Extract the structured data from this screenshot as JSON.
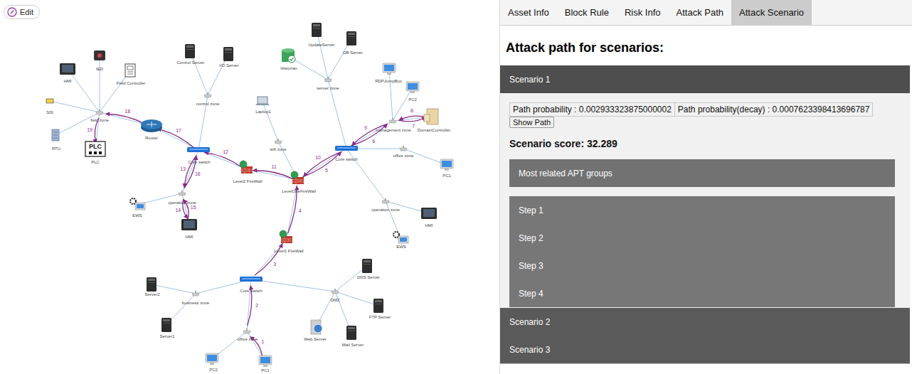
{
  "edit_button": {
    "label": "Edit"
  },
  "diagram": {
    "nodes": [
      {
        "label": "HMI",
        "kind": "hmi"
      },
      {
        "label": "IED",
        "kind": "ied"
      },
      {
        "label": "Field Controller",
        "kind": "controller"
      },
      {
        "label": "SIS",
        "kind": "sis"
      },
      {
        "label": "RTU",
        "kind": "rtu"
      },
      {
        "label": "PLC",
        "kind": "plc",
        "badge": "PLC"
      },
      {
        "label": "field zone",
        "kind": "hub"
      },
      {
        "label": "Router",
        "kind": "router"
      },
      {
        "label": "Control Server",
        "kind": "server"
      },
      {
        "label": "I/O Server",
        "kind": "server"
      },
      {
        "label": "control zone",
        "kind": "hub"
      },
      {
        "label": "Core switch",
        "kind": "switch"
      },
      {
        "label": "Level2 FireWall",
        "kind": "firewall"
      },
      {
        "label": "operation zone",
        "kind": "hub"
      },
      {
        "label": "EWS",
        "kind": "ews"
      },
      {
        "label": "HMI",
        "kind": "hmi"
      },
      {
        "label": "Laptop1",
        "kind": "laptop"
      },
      {
        "label": "wifi zone",
        "kind": "hub"
      },
      {
        "label": "LevelOneFireWall",
        "kind": "firewall"
      },
      {
        "label": "UpdateServer",
        "kind": "server"
      },
      {
        "label": "DB Server",
        "kind": "server"
      },
      {
        "label": "Historian",
        "kind": "db"
      },
      {
        "label": "server zone",
        "kind": "hub"
      },
      {
        "label": "RDPJumpBox",
        "kind": "pc"
      },
      {
        "label": "PC2",
        "kind": "pc"
      },
      {
        "label": "DomainController",
        "kind": "tower"
      },
      {
        "label": "management zone",
        "kind": "hub"
      },
      {
        "label": "Core switch",
        "kind": "switch"
      },
      {
        "label": "office zone",
        "kind": "hub"
      },
      {
        "label": "PC1",
        "kind": "pc"
      },
      {
        "label": "operation zone",
        "kind": "hub"
      },
      {
        "label": "HMI",
        "kind": "hmi"
      },
      {
        "label": "EWS",
        "kind": "ews"
      },
      {
        "label": "Level1 FireWall",
        "kind": "firewall"
      },
      {
        "label": "Core switch",
        "kind": "switch"
      },
      {
        "label": "business zone",
        "kind": "hub"
      },
      {
        "label": "Server2",
        "kind": "server"
      },
      {
        "label": "Server1",
        "kind": "server"
      },
      {
        "label": "office zone",
        "kind": "hub"
      },
      {
        "label": "PC2",
        "kind": "pc"
      },
      {
        "label": "PC1",
        "kind": "pc"
      },
      {
        "label": "DMZ",
        "kind": "hub"
      },
      {
        "label": "DNS Server",
        "kind": "server"
      },
      {
        "label": "FTP Server",
        "kind": "server"
      },
      {
        "label": "Web Server",
        "kind": "web"
      },
      {
        "label": "Mail Server",
        "kind": "server"
      }
    ],
    "attack_path": [
      {
        "step": "1"
      },
      {
        "step": "2"
      },
      {
        "step": "3"
      },
      {
        "step": "4"
      },
      {
        "step": "5"
      },
      {
        "step": "6"
      },
      {
        "step": "7"
      },
      {
        "step": "8"
      },
      {
        "step": "9"
      },
      {
        "step": "10"
      },
      {
        "step": "11"
      },
      {
        "step": "12"
      },
      {
        "step": "13"
      },
      {
        "step": "14"
      },
      {
        "step": "15"
      },
      {
        "step": "16"
      },
      {
        "step": "17"
      },
      {
        "step": "18"
      },
      {
        "step": "19"
      }
    ]
  },
  "tabs": [
    {
      "label": "Asset Info",
      "selected": false
    },
    {
      "label": "Block Rule",
      "selected": false
    },
    {
      "label": "Risk Info",
      "selected": false
    },
    {
      "label": "Attack Path",
      "selected": false
    },
    {
      "label": "Attack Scenario",
      "selected": true
    }
  ],
  "heading": "Attack path for scenarios:",
  "scenarios": [
    {
      "title": "Scenario 1",
      "expanded": true,
      "details": {
        "path_probability": "Path probability : 0.002933323875000002",
        "path_probability_decay": "Path probability(decay) : 0.0007623398413696787",
        "show_path_button": "Show Path",
        "score": "Scenario score: 32.289",
        "apt_groups": {
          "label": "Most related APT groups",
          "expanded": false
        },
        "steps": [
          {
            "label": "Step 1",
            "expanded": false
          },
          {
            "label": "Step 2",
            "expanded": false
          },
          {
            "label": "Step 3",
            "expanded": false
          },
          {
            "label": "Step 4",
            "expanded": false
          }
        ]
      }
    },
    {
      "title": "Scenario 2",
      "expanded": false
    },
    {
      "title": "Scenario 3",
      "expanded": false
    }
  ]
}
